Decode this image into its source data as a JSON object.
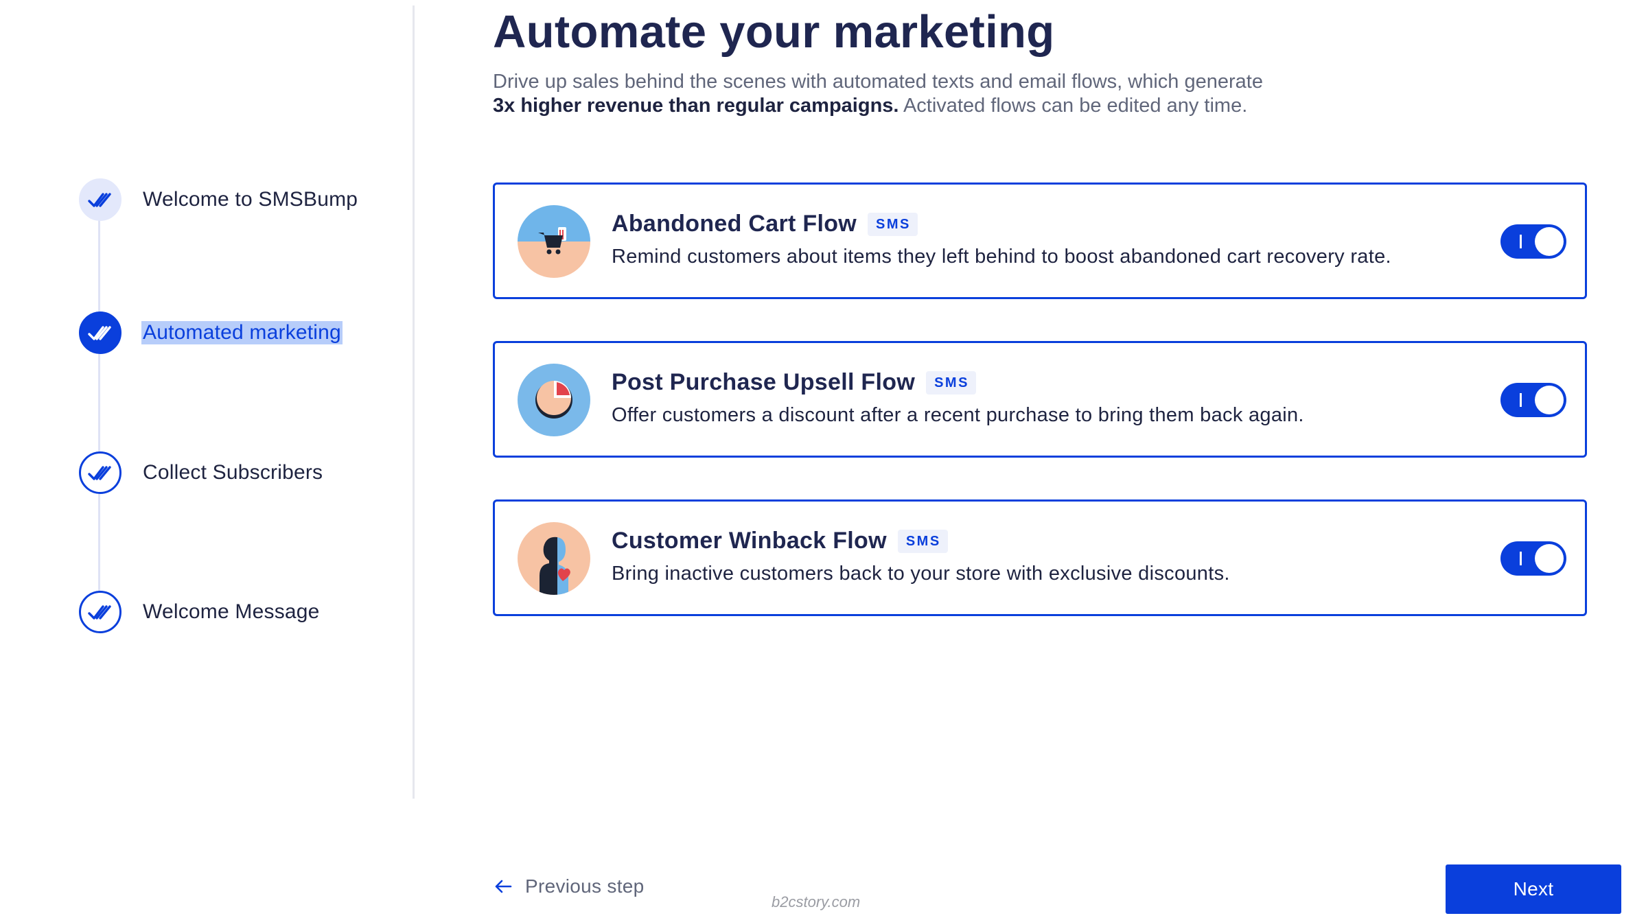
{
  "sidebar": {
    "steps": [
      {
        "label": "Welcome to SMSBump",
        "state": "done",
        "icon": "double-check-icon"
      },
      {
        "label": "Automated marketing",
        "state": "active",
        "icon": "double-check-icon"
      },
      {
        "label": "Collect Subscribers",
        "state": "pending",
        "icon": "double-check-icon"
      },
      {
        "label": "Welcome Message",
        "state": "pending",
        "icon": "double-check-icon"
      }
    ]
  },
  "main": {
    "title": "Automate your marketing",
    "subtitle_line1": "Drive up sales behind the scenes with automated texts and email flows, which generate",
    "subtitle_bold": "3x higher revenue than regular campaigns.",
    "subtitle_tail": " Activated flows can be edited any time.",
    "flows": [
      {
        "title": "Abandoned Cart Flow",
        "badge": "SMS",
        "description": "Remind customers about items they left behind to boost abandoned cart recovery rate.",
        "icon": "shopping-cart-icon",
        "enabled": true
      },
      {
        "title": "Post Purchase Upsell Flow",
        "badge": "SMS",
        "description": "Offer customers a discount after a recent purchase to bring them back again.",
        "icon": "pie-chart-icon",
        "enabled": true
      },
      {
        "title": "Customer Winback Flow",
        "badge": "SMS",
        "description": "Bring inactive customers back to your store with exclusive discounts.",
        "icon": "person-heart-icon",
        "enabled": true
      }
    ]
  },
  "footer": {
    "previous_label": "Previous step",
    "next_label": "Next",
    "watermark": "b2cstory.com"
  },
  "colors": {
    "accent": "#0a3fdc",
    "title": "#1f2650",
    "muted": "#60667a",
    "selection_highlight": "#b7cdfa"
  }
}
